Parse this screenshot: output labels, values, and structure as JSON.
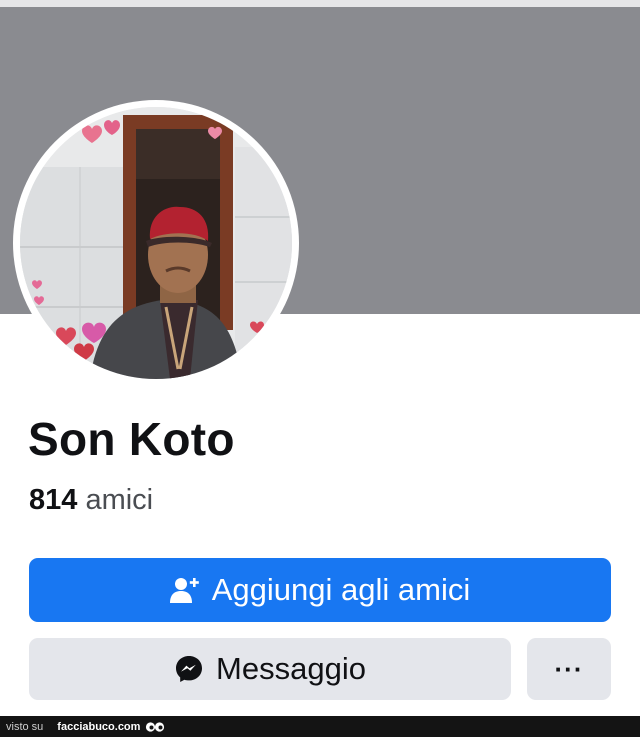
{
  "profile": {
    "name": "Son Koto",
    "friends_count": "814",
    "friends_label": "amici"
  },
  "actions": {
    "add_friend_label": "Aggiungi agli amici",
    "add_friend_icon": "add-person-icon",
    "message_label": "Messaggio",
    "message_icon": "messenger-icon",
    "more_label": "···",
    "more_icon": "more-icon"
  },
  "footer": {
    "prefix": "visto su",
    "site": "facciabuco.com"
  },
  "colors": {
    "accent": "#1877f2",
    "cover": "#8a8b90",
    "secondary_button": "#e4e6eb"
  }
}
